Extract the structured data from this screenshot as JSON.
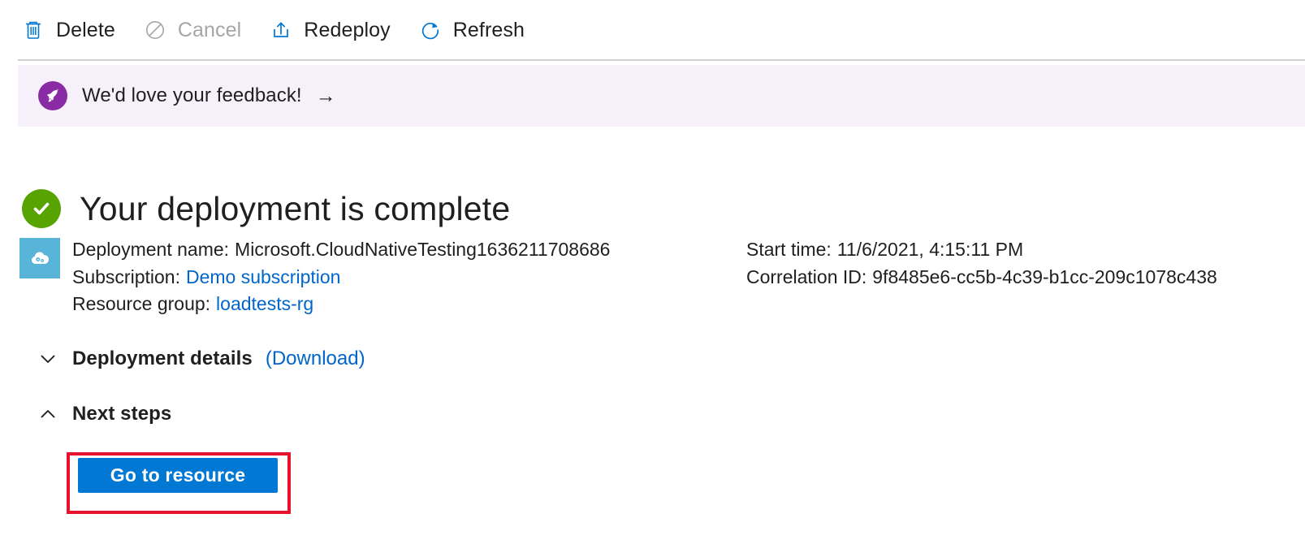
{
  "toolbar": {
    "buttons": [
      {
        "label": "Delete",
        "icon": "trash-icon",
        "disabled": false
      },
      {
        "label": "Cancel",
        "icon": "cancel-icon",
        "disabled": true
      },
      {
        "label": "Redeploy",
        "icon": "redeploy-icon",
        "disabled": false
      },
      {
        "label": "Refresh",
        "icon": "refresh-icon",
        "disabled": false
      }
    ]
  },
  "feedback_banner": {
    "icon": "rocket-icon",
    "text": "We'd love your feedback!",
    "arrow": "→",
    "background_color": "#f6f0fa",
    "icon_color": "#8a2ba6"
  },
  "status": {
    "icon": "success-check-icon",
    "icon_color": "#57a300",
    "title": "Your deployment is complete"
  },
  "summary": {
    "resource_icon": "cloud-gears-icon",
    "resource_icon_color": "#59b4d9",
    "left": [
      {
        "key": "Deployment name:",
        "value": "Microsoft.CloudNativeTesting1636211708686",
        "is_link": false
      },
      {
        "key": "Subscription:",
        "value": "Demo subscription",
        "is_link": true
      },
      {
        "key": "Resource group:",
        "value": "loadtests-rg",
        "is_link": true
      }
    ],
    "right": [
      {
        "key": "Start time:",
        "value": "11/6/2021, 4:15:11 PM",
        "is_link": false
      },
      {
        "key": "Correlation ID:",
        "value": "9f8485e6-cc5b-4c39-b1cc-209c1078c438",
        "is_link": false
      }
    ]
  },
  "sections": {
    "deployment_details": {
      "title": "Deployment details",
      "link": "(Download)",
      "expanded": false,
      "chevron": "chevron-down-icon"
    },
    "next_steps": {
      "title": "Next steps",
      "expanded": true,
      "chevron": "chevron-up-icon"
    }
  },
  "primary_action": {
    "label": "Go to resource",
    "color": "#0078d4",
    "highlight_color": "#e8112d"
  },
  "link_color": "#0066cc"
}
